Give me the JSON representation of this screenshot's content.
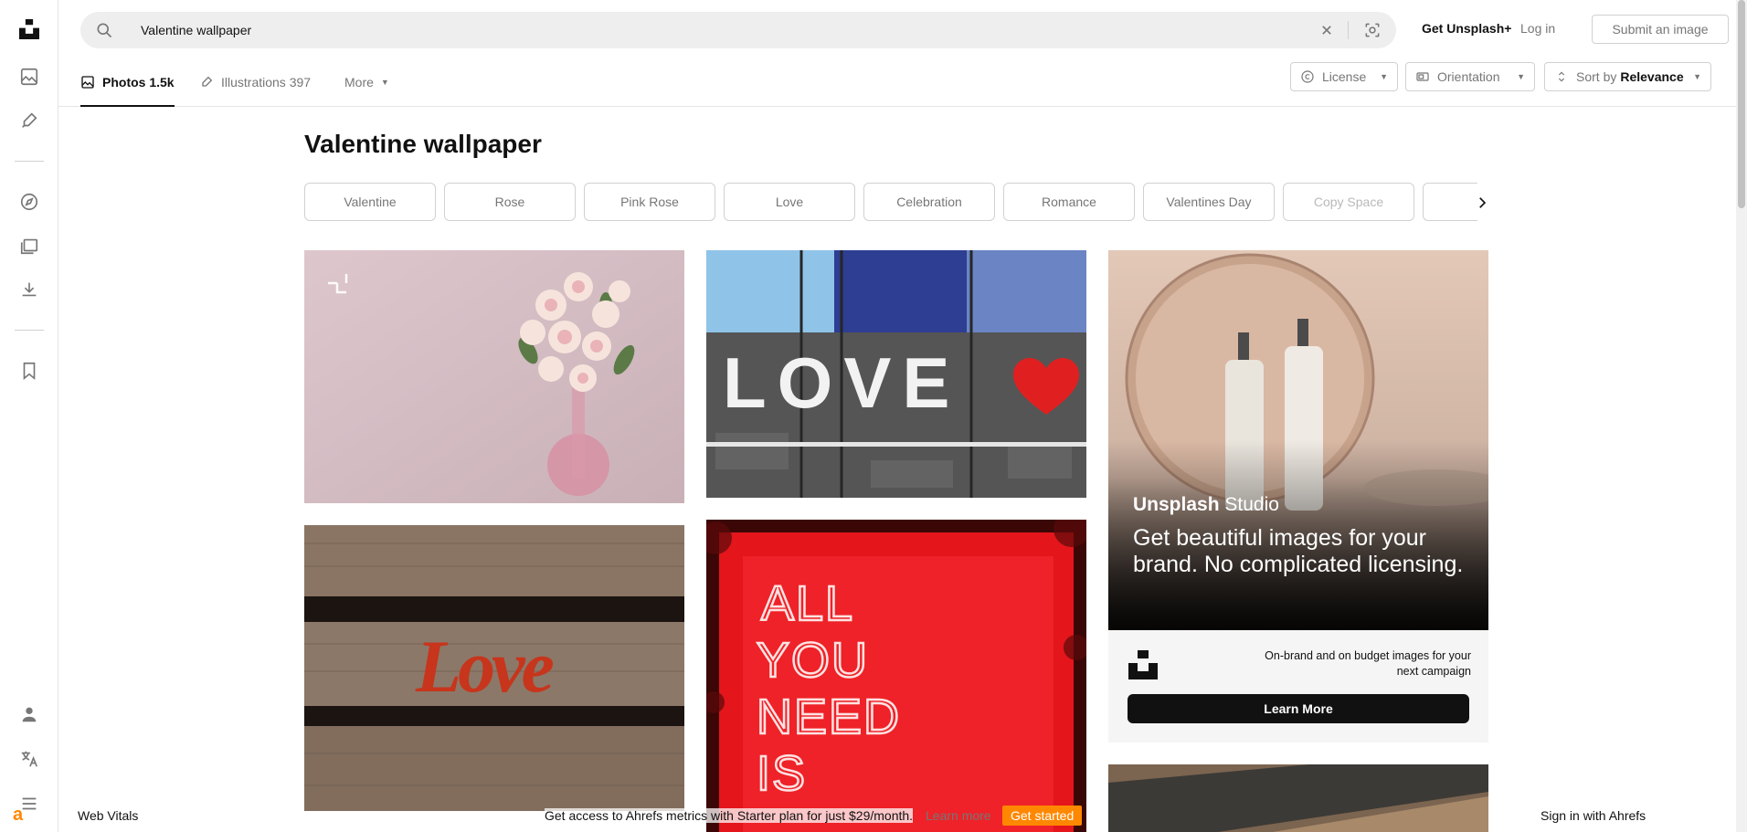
{
  "header": {
    "search_value": "Valentine wallpaper",
    "get_plus_label": "Get Unsplash+",
    "login_label": "Log in",
    "submit_label": "Submit an image"
  },
  "tabs": [
    {
      "label": "Photos 1.5k",
      "active": true
    },
    {
      "label": "Illustrations 397",
      "active": false
    },
    {
      "label": "More",
      "active": false
    }
  ],
  "filters": {
    "license_label": "License",
    "orientation_label": "Orientation",
    "sort_prefix": "Sort by",
    "sort_value": "Relevance"
  },
  "page_title": "Valentine wallpaper",
  "related": [
    "Valentine",
    "Rose",
    "Pink Rose",
    "Love",
    "Celebration",
    "Romance",
    "Valentines Day",
    "Copy Space"
  ],
  "images": {
    "card1_alt": "pink roses in vase",
    "card2_text": "LOVE",
    "card3_text": "Love",
    "card4_lines": [
      "ALL",
      "YOU",
      "NEED",
      "IS"
    ]
  },
  "ad": {
    "brand_bold": "Unsplash",
    "brand_rest": " Studio",
    "headline": "Get beautiful images for your brand. No complicated licensing.",
    "subtext": "On-brand and on budget images for your next campaign",
    "cta_label": "Learn More"
  },
  "toolbar": {
    "left_label": "Web Vitals",
    "message": "Get access to Ahrefs metrics with Starter plan for just $29/month.",
    "learn_label": "Learn more",
    "get_label": "Get started",
    "right_label": "Sign in with Ahrefs",
    "logo_letter": "a"
  },
  "colors": {
    "accent": "#111111",
    "muted": "#767676",
    "ahrefs_orange": "#ff8800"
  }
}
